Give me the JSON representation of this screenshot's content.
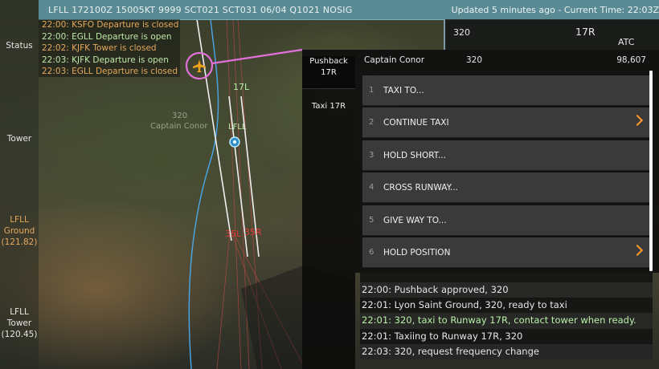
{
  "metar": {
    "text": "LFLL 172100Z 15005KT 9999 SCT021 SCT031 06/04 Q1021 NOSIG",
    "updated": "Updated 5 minutes ago - Current Time: 22:03Z"
  },
  "sidebar": {
    "items": [
      {
        "label_lines": [
          "Status"
        ]
      },
      {
        "label_lines": [
          "Tower"
        ]
      },
      {
        "label_lines": [
          "LFLL",
          "Ground",
          "(121.82)"
        ]
      },
      {
        "label_lines": [
          "LFLL",
          "Tower",
          "(120.45)"
        ]
      }
    ]
  },
  "events": [
    {
      "text": "22:00: KSFO Departure is closed",
      "status": "closed"
    },
    {
      "text": "22:00: EGLL Departure is open",
      "status": "open"
    },
    {
      "text": "22:02: KJFK Tower is closed",
      "status": "closed"
    },
    {
      "text": "22:03: KJFK Departure is open",
      "status": "open"
    },
    {
      "text": "22:03: EGLL Departure is closed",
      "status": "closed"
    }
  ],
  "strip": {
    "callsign": "320",
    "runway": "17R",
    "atc": "ATC"
  },
  "actions": {
    "pushback": [
      "Pushback",
      "17R"
    ],
    "taxi": "Taxi 17R"
  },
  "menu": {
    "header": {
      "callsign": "Captain Conor",
      "type": "320",
      "squawk": "98,607"
    },
    "items": [
      {
        "num": "1",
        "label": "TAXI TO...",
        "submenu": false
      },
      {
        "num": "2",
        "label": "CONTINUE TAXI",
        "submenu": true
      },
      {
        "num": "3",
        "label": "HOLD SHORT...",
        "submenu": false
      },
      {
        "num": "4",
        "label": "CROSS RUNWAY...",
        "submenu": false
      },
      {
        "num": "5",
        "label": "GIVE WAY TO...",
        "submenu": false
      },
      {
        "num": "6",
        "label": "HOLD POSITION",
        "submenu": true
      }
    ]
  },
  "transcript": [
    {
      "text": "22:00: Pushback approved, 320",
      "style": "normal"
    },
    {
      "text": "22:01: Lyon Saint Ground, 320, ready to taxi",
      "style": "normal"
    },
    {
      "text": "22:01: 320, taxi to Runway 17R, contact tower when ready.",
      "style": "green"
    },
    {
      "text": "22:01: Taxiing to Runway 17R, 320",
      "style": "normal"
    },
    {
      "text": "22:03: 320, request frequency change",
      "style": "normal"
    }
  ],
  "map": {
    "runway_top_left": "17L",
    "airport_code": "LFLL",
    "aircraft_type": "320",
    "aircraft_name": "Captain Conor",
    "runway_bottom_left": "35L",
    "runway_bottom_right": "35R"
  },
  "colors": {
    "metar_bar": "#5a8a93",
    "closed": "#e5a85b",
    "open": "#bfe8a8",
    "accent_chevron": "#ff9a2e",
    "selection_ring": "#e070d8",
    "runway_red": "#d63a3a"
  }
}
